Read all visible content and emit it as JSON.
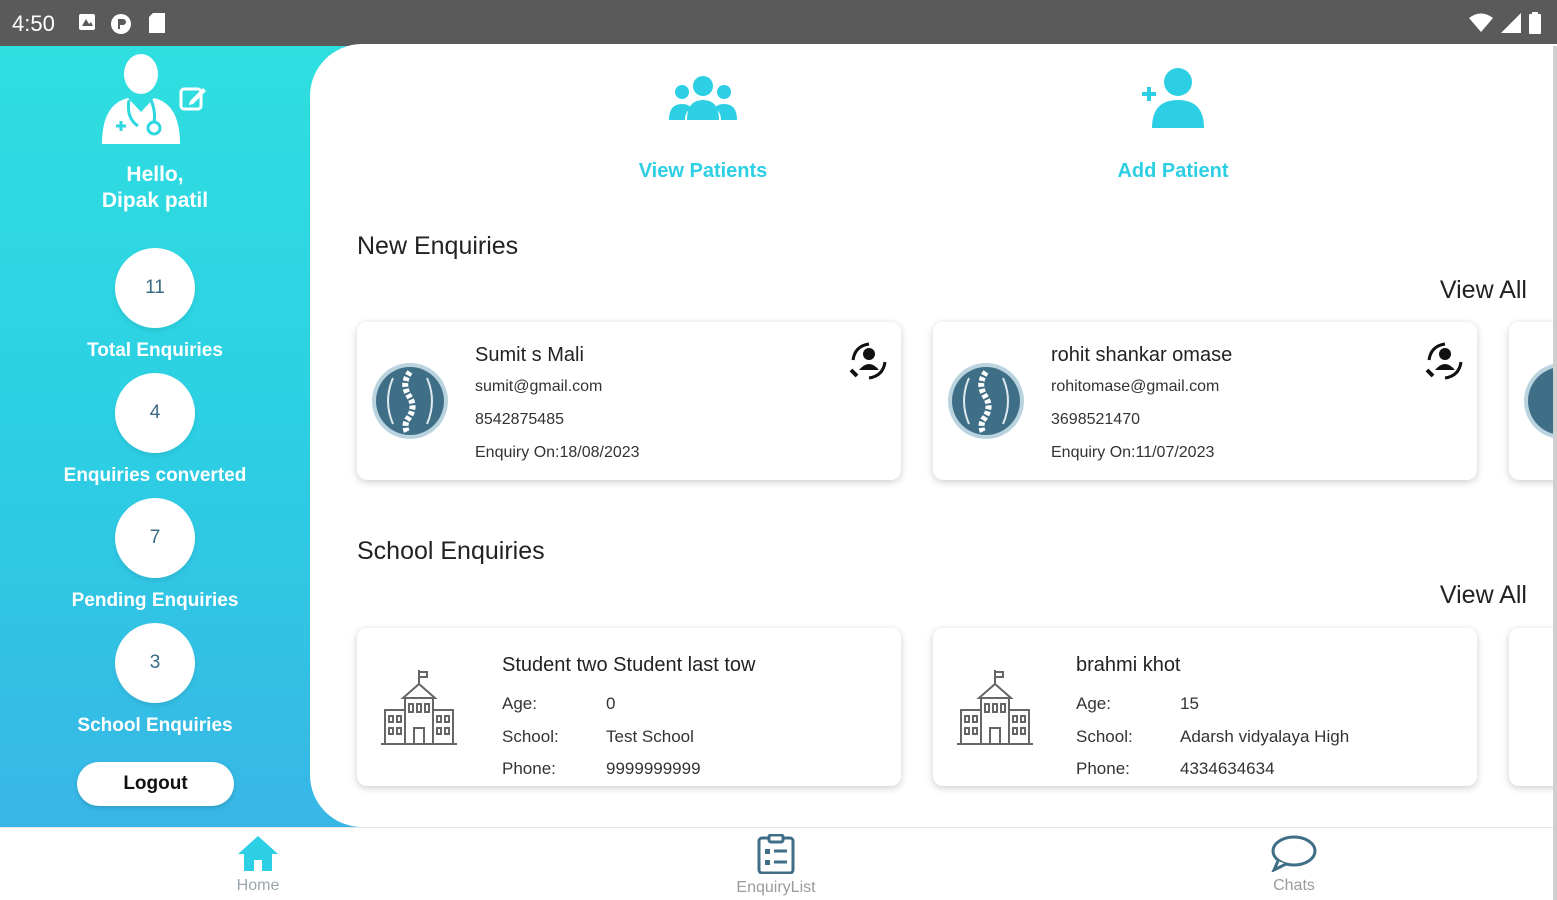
{
  "status_bar": {
    "time": "4:50"
  },
  "sidebar": {
    "greeting": "Hello,",
    "user_name": "Dipak patil",
    "stats": [
      {
        "value": "11",
        "label": "Total Enquiries"
      },
      {
        "value": "4",
        "label": "Enquiries converted"
      },
      {
        "value": "7",
        "label": "Pending Enquiries"
      },
      {
        "value": "3",
        "label": "School Enquiries"
      }
    ],
    "logout_label": "Logout"
  },
  "actions": {
    "view_patients": "View Patients",
    "add_patient": "Add Patient"
  },
  "new_enquiries": {
    "title": "New Enquiries",
    "view_all": "View All",
    "items": [
      {
        "name": "Sumit s Mali",
        "email": "sumit@gmail.com",
        "phone": "8542875485",
        "enquiry_on": "Enquiry On:18/08/2023"
      },
      {
        "name": "rohit shankar omase",
        "email": "rohitomase@gmail.com",
        "phone": "3698521470",
        "enquiry_on": "Enquiry On:11/07/2023"
      }
    ]
  },
  "school_enquiries": {
    "title": "School Enquiries",
    "view_all": "View All",
    "labels": {
      "age": "Age:",
      "school": "School:",
      "phone": "Phone:"
    },
    "items": [
      {
        "name": "Student two Student last tow",
        "age": "0",
        "school": "Test School",
        "phone": "9999999999"
      },
      {
        "name": "brahmi khot",
        "age": "15",
        "school": "Adarsh vidyalaya High",
        "phone": "4334634634"
      }
    ]
  },
  "bottom_nav": {
    "home": "Home",
    "enquiry_list": "EnquiryList",
    "chats": "Chats"
  },
  "colors": {
    "accent": "#2ccfe3",
    "spine_badge": "#3f6f87",
    "nav_home": "#2ccfe3",
    "nav_other": "#3f6f87"
  }
}
